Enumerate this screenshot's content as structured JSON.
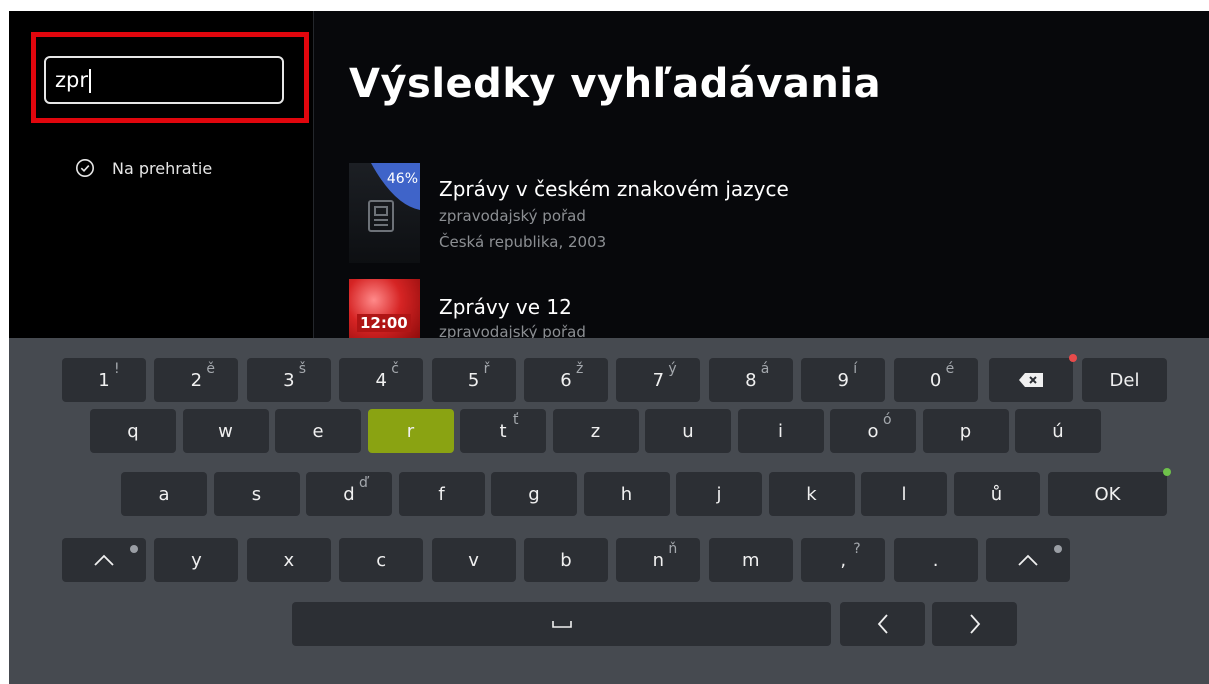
{
  "search": {
    "value": "zpr"
  },
  "filter": {
    "label": "Na prehratie",
    "icon": "check-circle-icon"
  },
  "page_title": "Výsledky vyhľadávania",
  "results": [
    {
      "title": "Zprávy v českém znakovém jazyce",
      "subtitle": "zpravodajský pořad",
      "meta": "Česká republika, 2003",
      "progress_label": "46%",
      "progress": 46
    },
    {
      "title": "Zprávy ve 12",
      "subtitle": "zpravodajský pořad",
      "badge": "12:00"
    }
  ],
  "keyboard": {
    "row1": [
      {
        "k": "1",
        "a": "!"
      },
      {
        "k": "2",
        "a": "ě"
      },
      {
        "k": "3",
        "a": "š"
      },
      {
        "k": "4",
        "a": "č"
      },
      {
        "k": "5",
        "a": "ř"
      },
      {
        "k": "6",
        "a": "ž"
      },
      {
        "k": "7",
        "a": "ý"
      },
      {
        "k": "8",
        "a": "á"
      },
      {
        "k": "9",
        "a": "í"
      },
      {
        "k": "0",
        "a": "é"
      },
      {
        "k": "backspace",
        "icon": "backspace-icon"
      },
      {
        "k": "Del"
      }
    ],
    "row2": [
      {
        "k": "q"
      },
      {
        "k": "w"
      },
      {
        "k": "e"
      },
      {
        "k": "r",
        "active": true
      },
      {
        "k": "t",
        "a": "ť"
      },
      {
        "k": "z"
      },
      {
        "k": "u"
      },
      {
        "k": "i"
      },
      {
        "k": "o",
        "a": "ó"
      },
      {
        "k": "p"
      },
      {
        "k": "ú"
      }
    ],
    "row3": [
      {
        "k": "a"
      },
      {
        "k": "s"
      },
      {
        "k": "d",
        "a": "ď"
      },
      {
        "k": "f"
      },
      {
        "k": "g"
      },
      {
        "k": "h"
      },
      {
        "k": "j"
      },
      {
        "k": "k"
      },
      {
        "k": "l"
      },
      {
        "k": "ů"
      },
      {
        "k": "OK"
      }
    ],
    "row4": [
      {
        "k": "shift-left",
        "icon": "shift-icon"
      },
      {
        "k": "y"
      },
      {
        "k": "x"
      },
      {
        "k": "c"
      },
      {
        "k": "v"
      },
      {
        "k": "b"
      },
      {
        "k": "n",
        "a": "ň"
      },
      {
        "k": "m"
      },
      {
        "k": ",",
        "a": "?"
      },
      {
        "k": "."
      },
      {
        "k": "shift-right",
        "icon": "shift-icon"
      }
    ],
    "row5": [
      {
        "k": "space",
        "icon": "space-icon"
      },
      {
        "k": "left",
        "icon": "arrow-left-icon"
      },
      {
        "k": "right",
        "icon": "arrow-right-icon"
      }
    ]
  },
  "colors": {
    "active_key": "#8aa312",
    "highlight": "#e1060d",
    "progress": "#3f64c9",
    "backspace_dot": "#e84b4b",
    "ok_dot": "#6ec14a"
  }
}
